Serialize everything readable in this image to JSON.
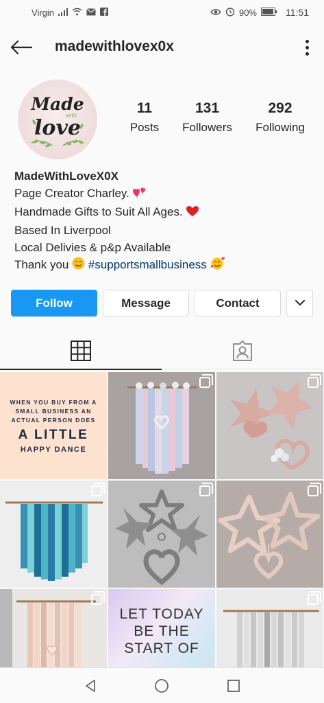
{
  "status_bar": {
    "carrier": "Virgin",
    "battery": "90%",
    "time": "11:51",
    "icons": [
      "signal-icon",
      "wifi-icon",
      "email-icon",
      "facebook-icon",
      "eye-icon",
      "alarm-icon",
      "battery-icon"
    ]
  },
  "header": {
    "username": "madewithlovex0x",
    "back_icon": "arrow-left-icon",
    "more_icon": "more-vertical-icon"
  },
  "profile": {
    "avatar_text": [
      "Made",
      "with",
      "love"
    ],
    "stats": [
      {
        "value": "11",
        "label": "Posts"
      },
      {
        "value": "131",
        "label": "Followers"
      },
      {
        "value": "292",
        "label": "Following"
      }
    ],
    "bio": {
      "name": "MadeWithLoveX0X",
      "line1": "Page Creator Charley.",
      "line2": "Handmade Gifts to Suit All Ages.",
      "line3": "Based In Liverpool",
      "line4": "Local Delivies & p&p Available",
      "line5_prefix": "Thank you",
      "hashtag": "#supportsmallbusiness"
    }
  },
  "actions": {
    "follow": "Follow",
    "message": "Message",
    "contact": "Contact"
  },
  "tabs": [
    {
      "name": "grid-icon",
      "active": true
    },
    {
      "name": "tagged-icon",
      "active": false
    }
  ],
  "posts": {
    "quote1": {
      "line1": "WHEN YOU BUY FROM A",
      "line2": "SMALL BUSINESS AN",
      "line3": "ACTUAL PERSON DOES",
      "big": "A LITTLE",
      "mid": "HAPPY DANCE"
    },
    "quote2": {
      "line1": "LET TODAY",
      "line2": "BE THE",
      "line3": "START OF"
    }
  },
  "colors": {
    "accent": "#1898f2",
    "hashtag": "#00376b",
    "text": "#262626"
  }
}
